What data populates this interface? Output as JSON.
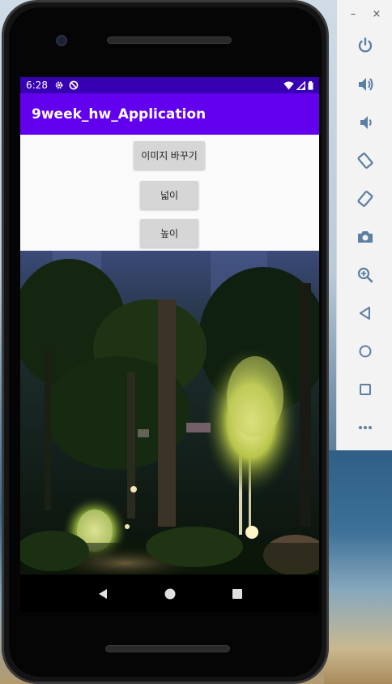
{
  "status_bar": {
    "time": "6:28"
  },
  "app": {
    "title": "9week_hw_Application"
  },
  "buttons": {
    "change_image": "이미지 바꾸기",
    "width": "넓이",
    "height": "높이"
  },
  "toolbar": {
    "minimize": "–",
    "close": "×",
    "tools": [
      "power-icon",
      "volume-up-icon",
      "volume-down-icon",
      "rotate-left-icon",
      "rotate-right-icon",
      "camera-icon",
      "zoom-icon",
      "back-icon",
      "home-icon",
      "overview-icon",
      "more-icon"
    ]
  },
  "colors": {
    "status_bar": "#3700b3",
    "app_bar": "#6200ee",
    "button": "#d6d6d6",
    "toolbar_icon": "#5c7fa3"
  }
}
